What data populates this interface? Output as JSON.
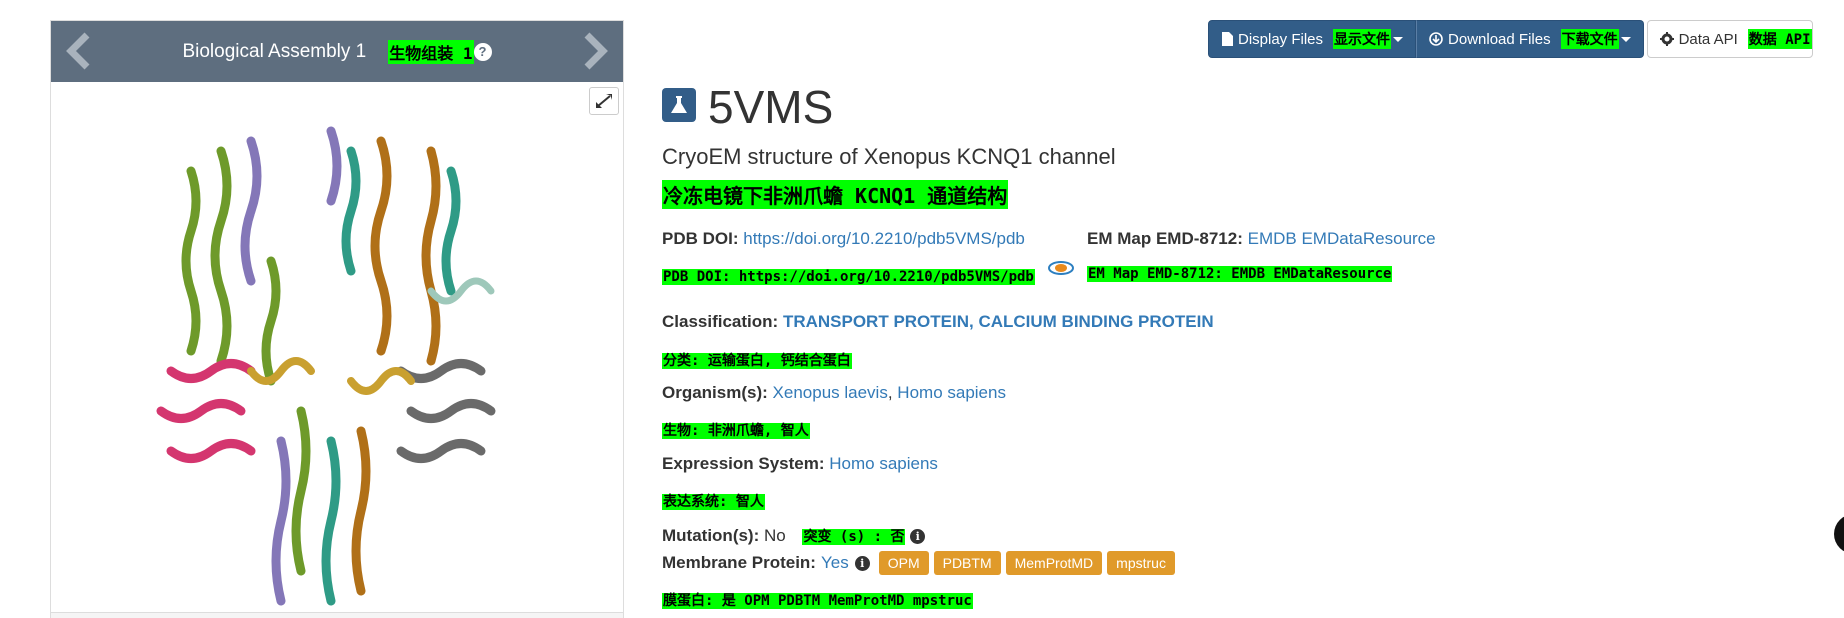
{
  "viewer": {
    "title": "Biological Assembly 1",
    "title_zh": "生物组装 1",
    "help": "?"
  },
  "toolbar": {
    "display_files": "Display Files",
    "display_files_zh": "显示文件",
    "download_files": "Download Files",
    "download_files_zh": "下载文件",
    "data_api": "Data API",
    "data_api_zh": "数据 API"
  },
  "entry": {
    "id": "5VMS",
    "title": "CryoEM structure of Xenopus KCNQ1 channel",
    "title_zh": "冷冻电镜下非洲爪蟾 KCNQ1 通道结构",
    "doi_label": "PDB DOI:",
    "doi_value": "https://doi.org/10.2210/pdb5VMS/pdb",
    "doi_zh": "PDB DOI: https://doi.org/10.2210/pdb5VMS/pdb",
    "emmap_label": "EM Map EMD-8712:",
    "emmap_link1": "EMDB",
    "emmap_link2": "EMDataResource",
    "emmap_zh": "EM Map EMD-8712: EMDB EMDataResource",
    "classification_label": "Classification:",
    "classification_value": "TRANSPORT PROTEIN, CALCIUM BINDING PROTEIN",
    "classification_zh": "分类: 运输蛋白, 钙结合蛋白",
    "organism_label": "Organism(s):",
    "organism_1": "Xenopus laevis",
    "organism_sep": ", ",
    "organism_2": "Homo sapiens",
    "organism_zh": "生物: 非洲爪蟾, 智人",
    "expression_label": "Expression System:",
    "expression_value": "Homo sapiens",
    "expression_zh": "表达系统: 智人",
    "mutation_label": "Mutation(s):",
    "mutation_value": "No",
    "mutation_zh": "突变 (s) : 否",
    "membrane_label": "Membrane Protein:",
    "membrane_value": "Yes",
    "membrane_tags": [
      "OPM",
      "PDBTM",
      "MemProtMD",
      "mpstruc"
    ],
    "membrane_zh": "膜蛋白: 是 OPM PDBTM MemProtMD mpstruc"
  },
  "colors": {
    "header_bg": "#5e6e7f",
    "primary": "#325d88",
    "link": "#337ab7",
    "tag": "#e09a2a",
    "highlight": "#00ff00"
  },
  "icons": {
    "prev": "chevron-left-icon",
    "next": "chevron-right-icon",
    "expand": "expand-icon",
    "file": "file-icon",
    "download": "download-icon",
    "api": "gear-icon",
    "entry": "flask-icon",
    "emdb": "emdb-logo",
    "info": "info-icon"
  }
}
